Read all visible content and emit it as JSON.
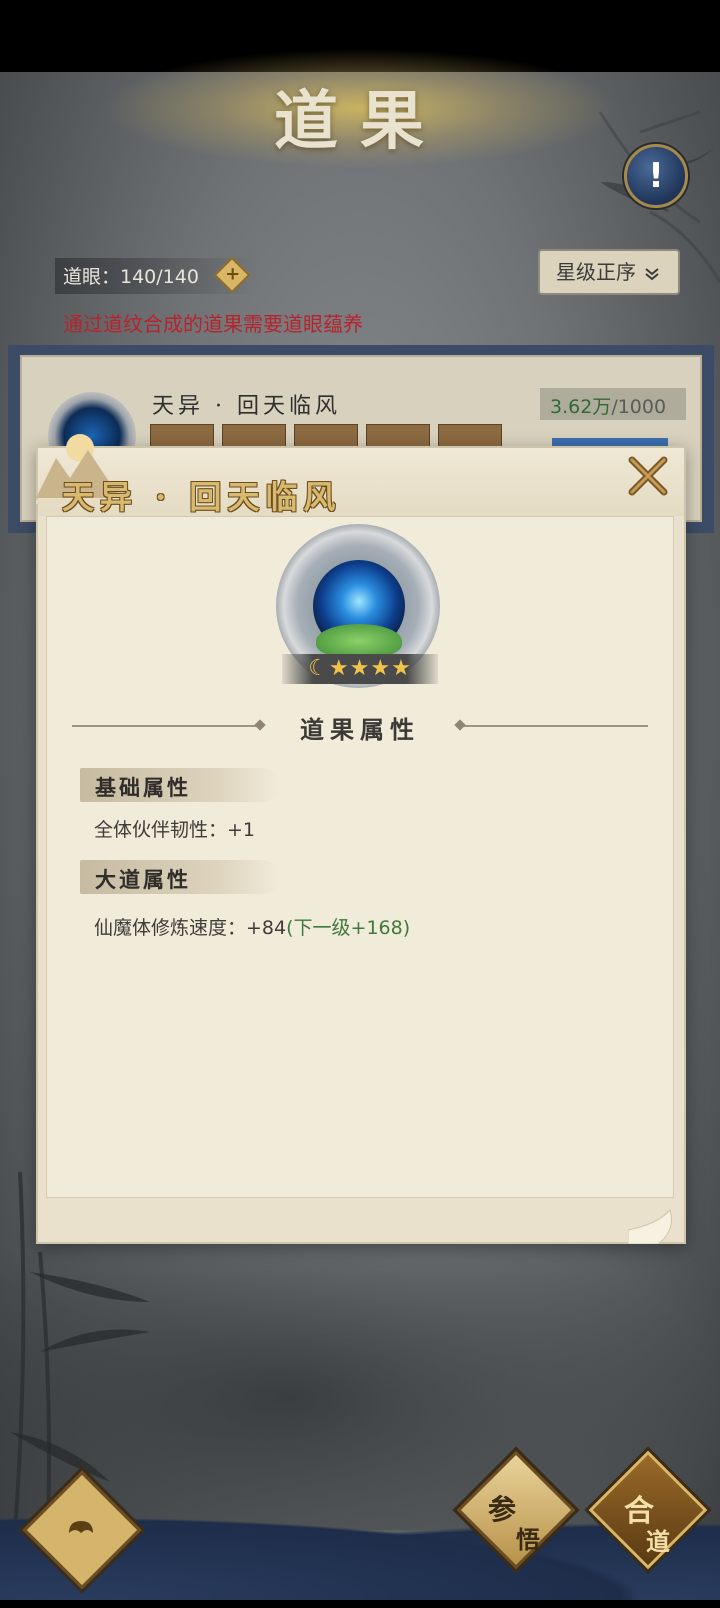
{
  "header": {
    "title": "道果"
  },
  "resource": {
    "label": "道眼：140/140",
    "plus_icon": "plus-icon"
  },
  "sort": {
    "label": "星级正序",
    "chevron": "double-chevron-down-icon"
  },
  "hint": "通过道纹合成的道果需要道眼蕴养",
  "card": {
    "name": "天异 · 回天临风",
    "cost_value": "3.62万",
    "cost_max": "/1000"
  },
  "popup": {
    "title": "天异 · 回天临风",
    "stars": "☾★★★★",
    "section_title": "道果属性",
    "base_heading": "基础属性",
    "base_attr": "全体伙伴韧性：+1",
    "dao_heading": "大道属性",
    "dao_attr_main": "仙魔体修炼速度：+84",
    "dao_attr_next": "(下一级+168)"
  },
  "bottom": {
    "insight_line1": "参",
    "insight_line2": "悟",
    "merge_line1": "合",
    "merge_line2": "道"
  },
  "colors": {
    "hint_red": "#b8232b",
    "green_value": "#3f7a3a",
    "gold": "#d8ba6e"
  }
}
